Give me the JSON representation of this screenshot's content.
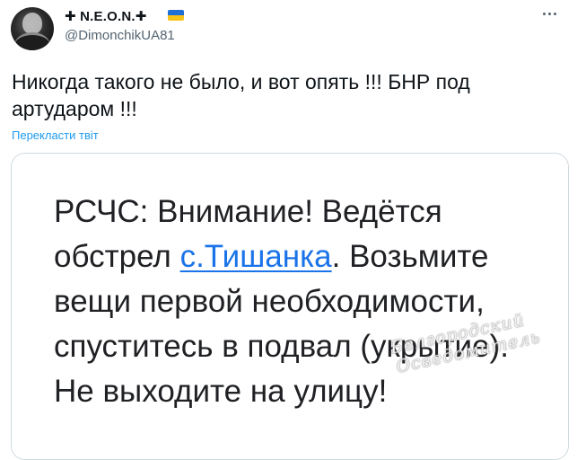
{
  "author": {
    "display_name": "✚ N.E.O.N.✚",
    "handle": "@DimonchikUA81",
    "flag_icon": "flag-ukraine-icon"
  },
  "menu": {
    "more_icon": "more-horizontal-icon"
  },
  "tweet": {
    "text": "Никогда такого не было, и вот опять !!! БНР под артударом !!!",
    "translate_label": "Перекласти твіт"
  },
  "media": {
    "alert": {
      "lead": "РСЧС: Внимание! Ведётся обстрел ",
      "link": "с.Тишанка",
      "rest": ". Возьмите вещи первой необходимости, спуститесь в подвал (укрытие). Не выходите на улицу!"
    },
    "watermark": {
      "line1": "Белгородский",
      "line2": "Осведомитель"
    }
  },
  "colors": {
    "text": "#0f1419",
    "secondary": "#536471",
    "link": "#1d9bf0",
    "alert_link": "#1a73e8",
    "border": "#cfd9de"
  }
}
